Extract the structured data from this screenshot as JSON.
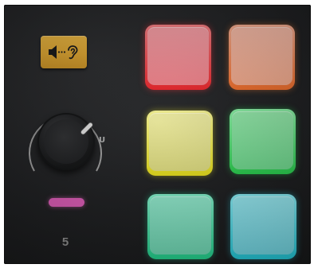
{
  "device": {
    "bank_number": "5",
    "knob_unity_label": "U",
    "monitor_button_icon": "speaker-ear-icon",
    "led_color": "#d95bb4"
  },
  "pads": [
    {
      "name": "pad-1",
      "color": "#ec8088"
    },
    {
      "name": "pad-2",
      "color": "#eea78a"
    },
    {
      "name": "pad-3",
      "color": "#d8d67c"
    },
    {
      "name": "pad-4",
      "color": "#6dd48b"
    },
    {
      "name": "pad-5",
      "color": "#6fd7b3"
    },
    {
      "name": "pad-6",
      "color": "#72d6e2"
    }
  ]
}
